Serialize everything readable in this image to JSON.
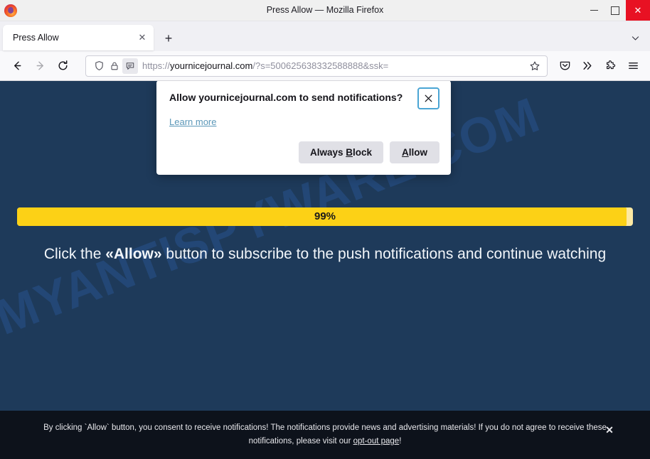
{
  "window": {
    "title": "Press Allow — Mozilla Firefox",
    "minimize_label": "Minimize",
    "maximize_label": "Maximize",
    "close_label": "✕"
  },
  "tabstrip": {
    "tab_title": "Press Allow",
    "tab_close_label": "✕",
    "newtab_label": "+",
    "list_all_tabs_label": "⌄"
  },
  "navbar": {
    "back_label": "←",
    "forward_label": "→",
    "reload_label": "⟳",
    "url_display_prefix": "https://",
    "url_display_host": "yournicejournal.com",
    "url_display_path": "/?s=500625638332588888&ssk=",
    "bookmark_label": "☆",
    "pocket_label": "Save to Pocket",
    "overflow_label": "»",
    "extensions_label": "Extensions",
    "appmenu_label": "Open application menu"
  },
  "doorhanger": {
    "title": "Allow yournicejournal.com to send notifications?",
    "close_label": "✕",
    "learn_more": "Learn more",
    "always_block_pre": "Always ",
    "always_block_accel": "B",
    "always_block_post": "lock",
    "allow_accel": "A",
    "allow_post": "llow"
  },
  "page": {
    "watermark": "MYANTISPYWARE.COM",
    "progress_percent_label": "99%",
    "progress_percent_value": 99,
    "cta_before": "Click the ",
    "cta_bold": "«Allow»",
    "cta_after": " button to subscribe to the push notifications and continue watching",
    "consent_line1": "By clicking `Allow` button, you consent to receive notifications! The notifications provide news and advertising materials! If you do not agree to receive",
    "consent_line2_before": "these notifications, please visit our ",
    "consent_link": "opt-out page",
    "consent_line2_after": "!",
    "consent_close_label": "✕"
  },
  "colors": {
    "page_background": "#1e3a5a",
    "progress_fill": "#fcd116",
    "progress_track": "#fde9a3",
    "consent_bar": "#0d121b",
    "watermark": "#2f67b8",
    "close_button": "#e81123",
    "focus_ring": "#4aa5d4"
  }
}
